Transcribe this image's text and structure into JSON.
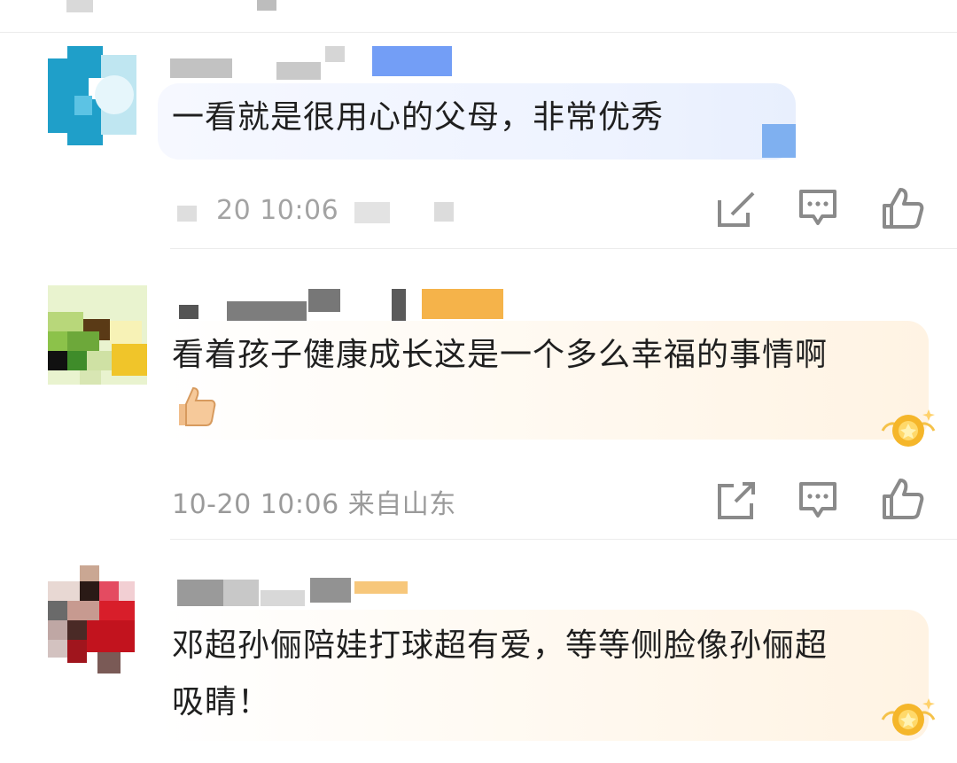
{
  "comments": [
    {
      "text": "一看就是很用心的父母，非常优秀",
      "meta": "20 10:06",
      "bubble": "blue"
    },
    {
      "text_line1": "看着孩子健康成长这是一个多么幸福的事情啊",
      "emoji": "thumbs-up",
      "meta": "10-20 10:06 来自山东",
      "bubble": "gold"
    },
    {
      "text_line1": "邓超孙俪陪娃打球超有爱，等等侧脸像孙俪超",
      "text_line2": "吸睛！",
      "bubble": "gold"
    }
  ],
  "actions": {
    "share_icon": "share-edit-icon",
    "comment_icon": "comment-icon",
    "like_icon": "like-icon"
  },
  "colors": {
    "meta": "#9a9a9a",
    "icon": "#8a8a8a",
    "text": "#1f1f1f",
    "gold_badge": "#f5b62a"
  }
}
